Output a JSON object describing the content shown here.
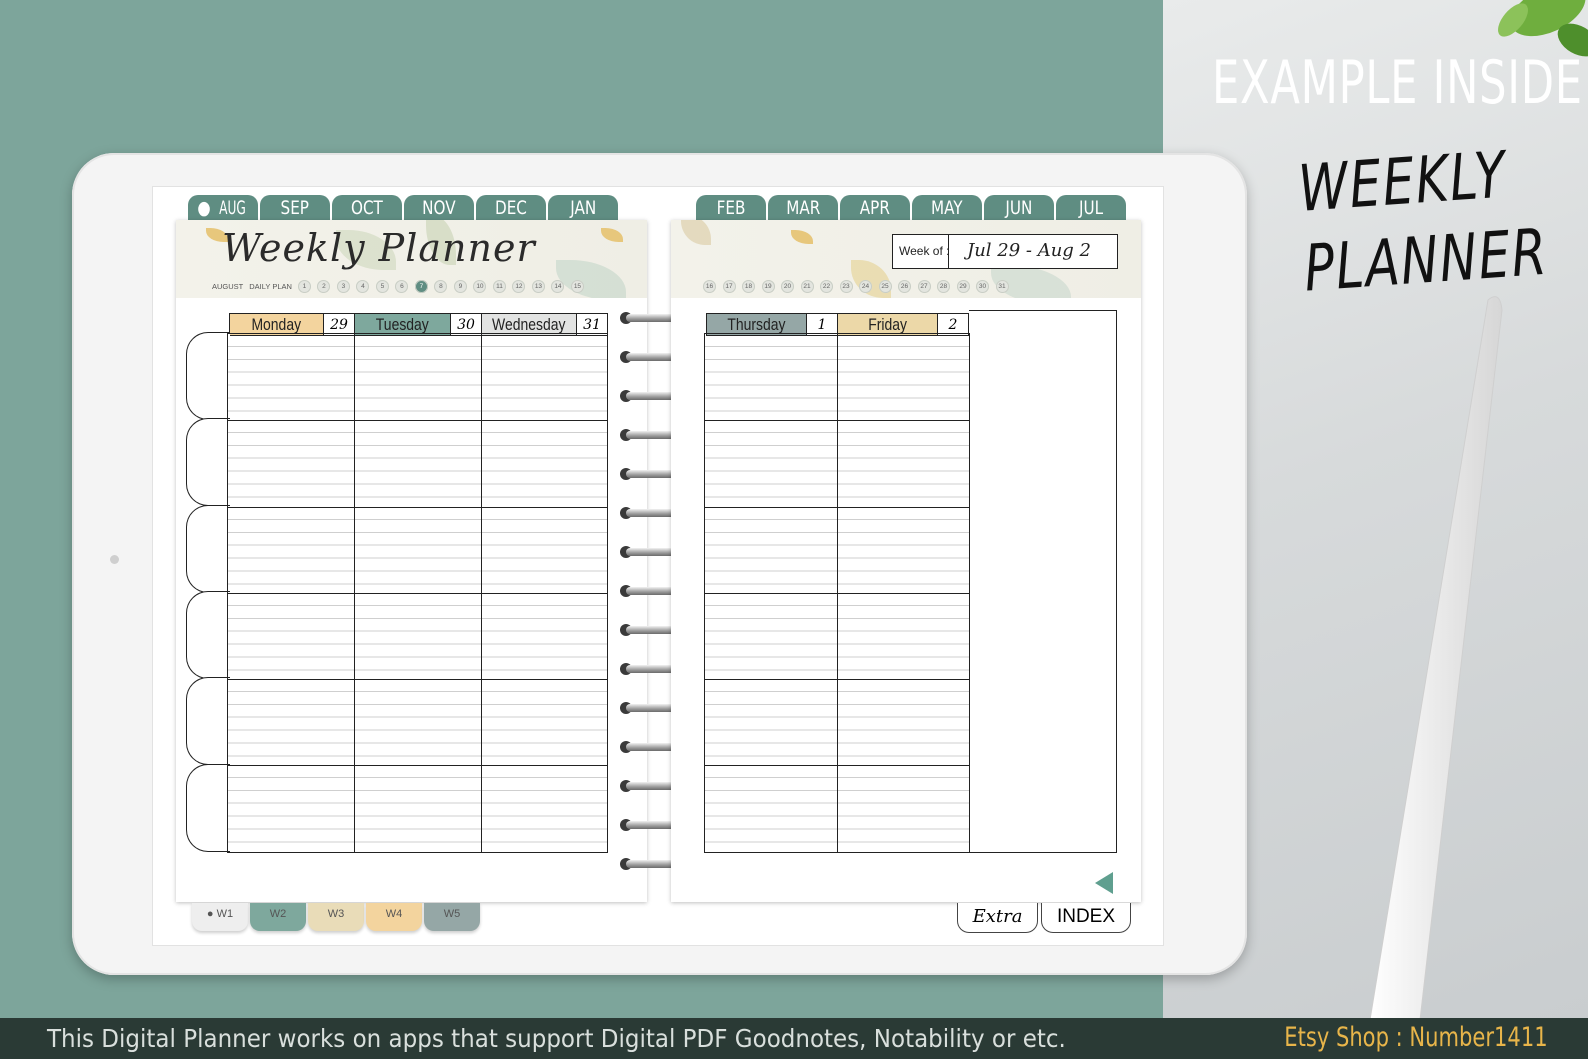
{
  "promo": {
    "title": "EXAMPLE INSIDE :",
    "handwritten_line1": "WEEKLY",
    "handwritten_line2": "PLANNER"
  },
  "footer": {
    "text": "This Digital Planner works on apps that support Digital PDF Goodnotes, Notability or etc.",
    "shop": "Etsy Shop : Number1411"
  },
  "left_tabs": [
    "AUG",
    "SEP",
    "OCT",
    "NOV",
    "DEC",
    "JAN"
  ],
  "right_tabs": [
    "FEB",
    "MAR",
    "APR",
    "MAY",
    "JUN",
    "JUL"
  ],
  "active_tab": "AUG",
  "planner": {
    "title": "Weekly Planner",
    "month_label": "AUGUST",
    "daily_plan_label": "DAILY PLAN",
    "left_dates": [
      "1",
      "2",
      "3",
      "4",
      "5",
      "6",
      "7",
      "8",
      "9",
      "10",
      "11",
      "12",
      "13",
      "14",
      "15"
    ],
    "right_dates": [
      "16",
      "17",
      "18",
      "19",
      "20",
      "21",
      "22",
      "23",
      "24",
      "25",
      "26",
      "27",
      "28",
      "29",
      "30",
      "31"
    ],
    "week_of_label": "Week of :",
    "week_of_value": "Jul 29 - Aug 2"
  },
  "days_left": [
    {
      "name": "Monday",
      "num": "29",
      "color": "#f3d49e"
    },
    {
      "name": "Tuesday",
      "num": "30",
      "color": "#7ea89d"
    },
    {
      "name": "Wednesday",
      "num": "31",
      "color": "#e2e3e2"
    }
  ],
  "days_right": [
    {
      "name": "Thursday",
      "num": "1",
      "color": "#95a7a6"
    },
    {
      "name": "Friday",
      "num": "2",
      "color": "#ecd8a8"
    }
  ],
  "week_tabs": [
    {
      "label": "W1",
      "color": "#eeeeee"
    },
    {
      "label": "W2",
      "color": "#7ea89d"
    },
    {
      "label": "W3",
      "color": "#e9dcb8"
    },
    {
      "label": "W4",
      "color": "#f3d49e"
    },
    {
      "label": "W5",
      "color": "#95a7a6"
    }
  ],
  "bottom_buttons": {
    "extra": "Extra",
    "index": "INDEX"
  },
  "colors": {
    "accent": "#5f8d82",
    "background": "#7da59b"
  }
}
